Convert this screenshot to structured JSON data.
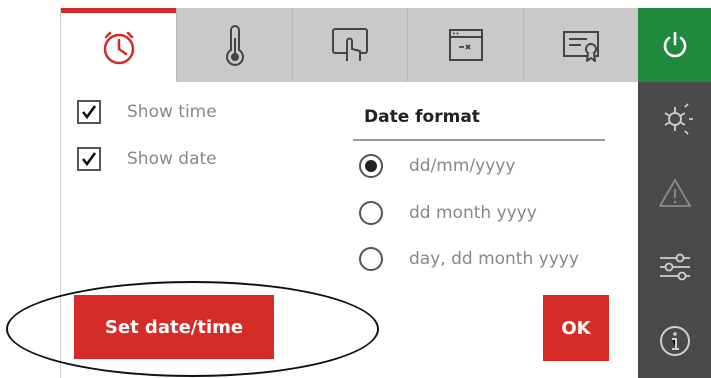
{
  "tabs": [
    {
      "icon": "clock-icon",
      "active": true
    },
    {
      "icon": "thermometer-icon",
      "active": false
    },
    {
      "icon": "touch-screen-icon",
      "active": false
    },
    {
      "icon": "browser-window-icon",
      "active": false
    },
    {
      "icon": "certificate-icon",
      "active": false
    }
  ],
  "rail": [
    {
      "icon": "power-icon"
    },
    {
      "icon": "heat-cool-icon"
    },
    {
      "icon": "warning-icon"
    },
    {
      "icon": "sliders-icon"
    },
    {
      "icon": "info-icon"
    }
  ],
  "options": {
    "show_time": {
      "label": "Show time",
      "checked": true
    },
    "show_date": {
      "label": "Show date",
      "checked": true
    }
  },
  "date_format": {
    "title": "Date format",
    "options": [
      "dd/mm/yyyy",
      "dd month yyyy",
      "day, dd month yyyy"
    ],
    "selected": 0
  },
  "buttons": {
    "set_datetime": "Set date/time",
    "ok": "OK"
  },
  "colors": {
    "accent_red": "#d62b27",
    "power_green": "#1f8a3c",
    "rail_dark": "#4a4a4a",
    "tab_gray": "#c9c9c9"
  }
}
